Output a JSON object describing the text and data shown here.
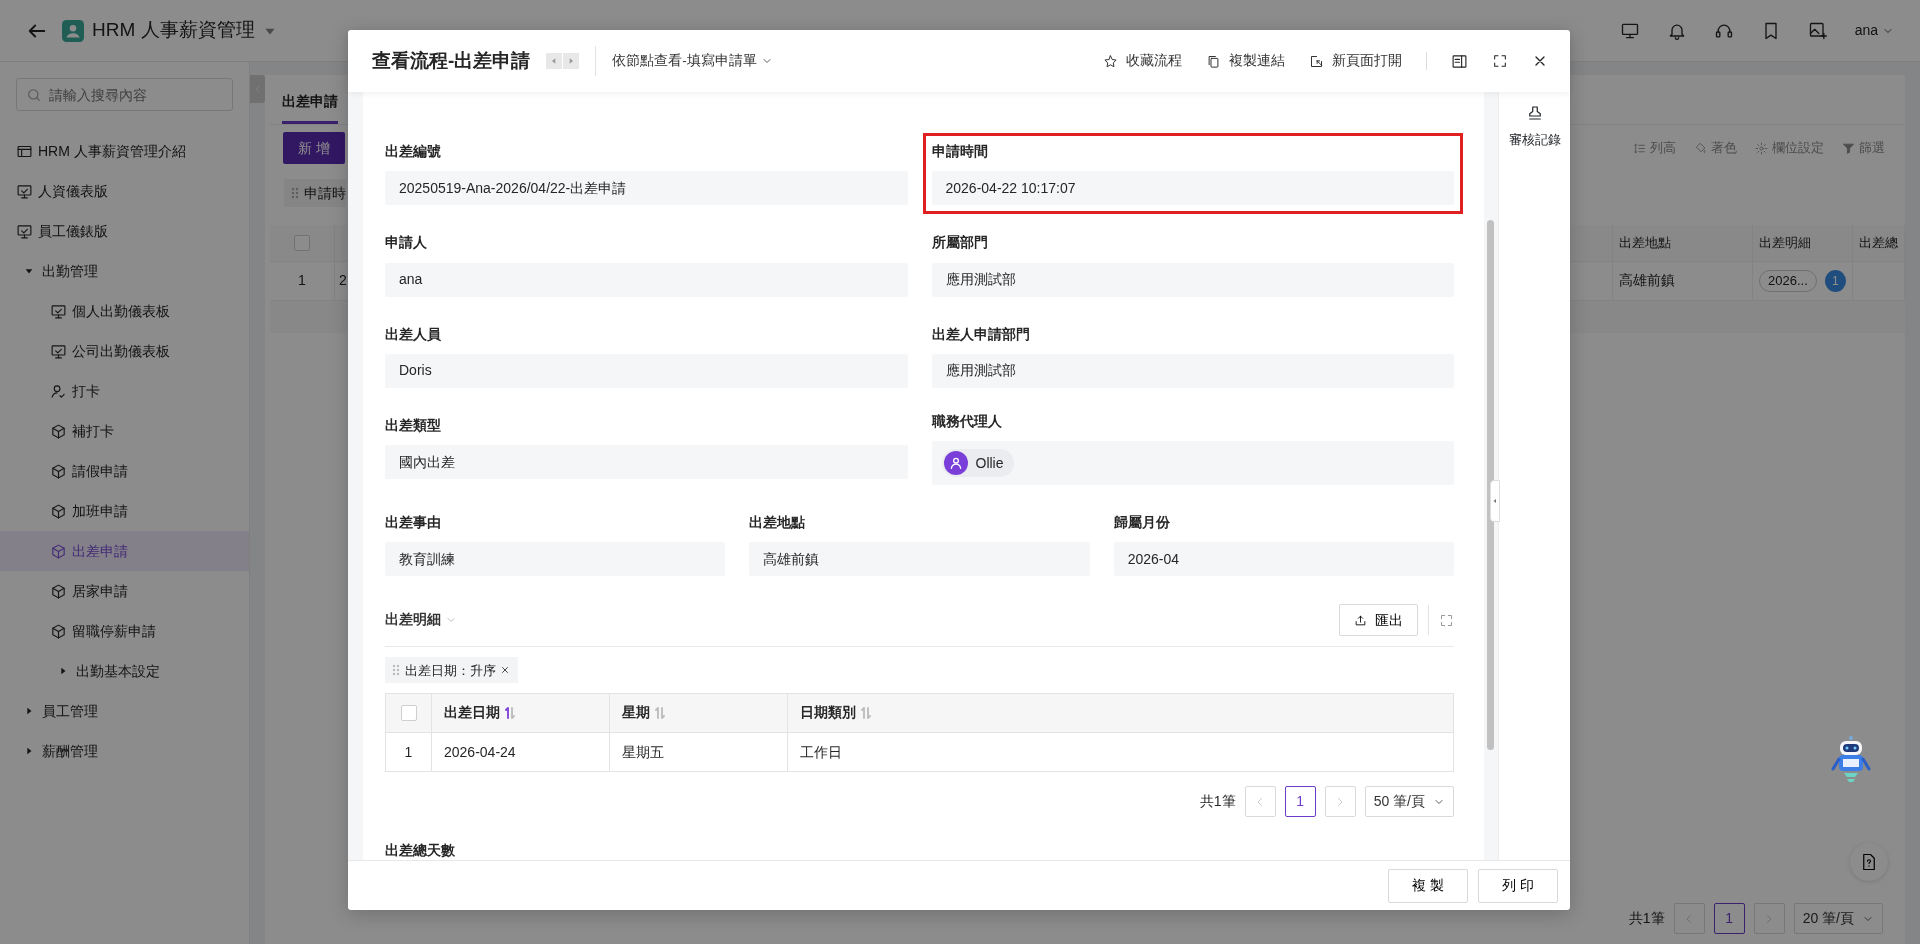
{
  "app_header": {
    "title": "HRM 人事薪資管理",
    "user": "ana"
  },
  "sidebar": {
    "search": {
      "placeholder": "請輸入搜尋內容"
    },
    "items": [
      {
        "label": "HRM 人事薪資管理介紹",
        "kind": "table",
        "selected": false
      },
      {
        "label": "人資儀表版",
        "kind": "dashboard",
        "selected": false
      },
      {
        "label": "員工儀錶版",
        "kind": "dashboard",
        "selected": false
      },
      {
        "label": "出勤管理",
        "kind": "group",
        "expanded": true,
        "selected": false,
        "children": [
          {
            "label": "個人出勤儀表板",
            "kind": "dashboard",
            "selected": false
          },
          {
            "label": "公司出勤儀表板",
            "kind": "dashboard",
            "selected": false
          },
          {
            "label": "打卡",
            "kind": "user",
            "selected": false
          },
          {
            "label": "補打卡",
            "kind": "cube",
            "selected": false
          },
          {
            "label": "請假申請",
            "kind": "cube",
            "selected": false
          },
          {
            "label": "加班申請",
            "kind": "cube",
            "selected": false
          },
          {
            "label": "出差申請",
            "kind": "cube",
            "selected": true
          },
          {
            "label": "居家申請",
            "kind": "cube",
            "selected": false
          },
          {
            "label": "留職停薪申請",
            "kind": "cube",
            "selected": false
          },
          {
            "label": "出勤基本設定",
            "kind": "group",
            "expanded": false,
            "selected": false
          }
        ]
      },
      {
        "label": "員工管理",
        "kind": "group",
        "expanded": false,
        "selected": false
      },
      {
        "label": "薪酬管理",
        "kind": "group",
        "expanded": false,
        "selected": false
      }
    ]
  },
  "background": {
    "tab": "出差申請",
    "add_button": "新 增",
    "chip": "申請時",
    "toolbar": [
      {
        "label": "列高",
        "kind": "height"
      },
      {
        "label": "著色",
        "kind": "paint"
      },
      {
        "label": "欄位設定",
        "kind": "gear"
      },
      {
        "label": "篩選",
        "kind": "filter"
      }
    ],
    "table": {
      "select_all_checked": false,
      "columns": [
        "出差地點",
        "出差明細",
        "出差總"
      ],
      "rows": [
        {
          "index": "1",
          "column_2": "2",
          "location": "高雄前鎮",
          "detail": "2026...",
          "detail_count": "1"
        }
      ]
    },
    "pagination": {
      "total": "共1筆",
      "page": "1",
      "page_size": "20 筆/頁"
    }
  },
  "modal": {
    "title": "查看流程-出差申請",
    "view_selector": "依節點查看-填寫申請單",
    "actions": [
      {
        "label": "收藏流程",
        "kind": "star"
      },
      {
        "label": "複製連結",
        "kind": "copy"
      },
      {
        "label": "新頁面打開",
        "kind": "open"
      }
    ],
    "side_panel": {
      "label": "審核記錄"
    },
    "field_rows": [
      [
        {
          "label": "出差編號",
          "value": "20250519-Ana-2026/04/22-出差申請",
          "kind": "text",
          "highlighted": false
        },
        {
          "label": "申請時間",
          "value": "2026-04-22 10:17:07",
          "kind": "text",
          "highlighted": true
        }
      ],
      [
        {
          "label": "申請人",
          "value": "ana",
          "kind": "text",
          "highlighted": false
        },
        {
          "label": "所屬部門",
          "value": "應用測試部",
          "kind": "text",
          "highlighted": false
        }
      ],
      [
        {
          "label": "出差人員",
          "value": "Doris",
          "kind": "text",
          "highlighted": false
        },
        {
          "label": "出差人申請部門",
          "value": "應用測試部",
          "kind": "text",
          "highlighted": false
        }
      ],
      [
        {
          "label": "出差類型",
          "value": "國內出差",
          "kind": "text",
          "highlighted": false
        },
        {
          "label": "職務代理人",
          "value": "Ollie",
          "kind": "person",
          "highlighted": false
        }
      ],
      [
        {
          "label": "出差事由",
          "value": "教育訓練",
          "kind": "text",
          "highlighted": false
        },
        {
          "label": "出差地點",
          "value": "高雄前鎮",
          "kind": "text",
          "highlighted": false
        },
        {
          "label": "歸屬月份",
          "value": "2026-04",
          "kind": "text",
          "highlighted": false
        }
      ]
    ],
    "detail": {
      "title": "出差明細",
      "export_button": "匯出",
      "sort_chip": "出差日期：升序",
      "select_all_checked": false,
      "columns": [
        {
          "label": "出差日期",
          "sort_active": true
        },
        {
          "label": "星期",
          "sort_active": false
        },
        {
          "label": "日期類別",
          "sort_active": false
        }
      ],
      "rows": [
        {
          "index": "1",
          "cells": [
            "2026-04-24",
            "星期五",
            "工作日"
          ]
        }
      ],
      "pagination": {
        "total": "共1筆",
        "page": "1",
        "page_size": "50 筆/頁"
      }
    },
    "next_field_label": "出差總天數",
    "footer_buttons": [
      "複 製",
      "列 印"
    ]
  }
}
